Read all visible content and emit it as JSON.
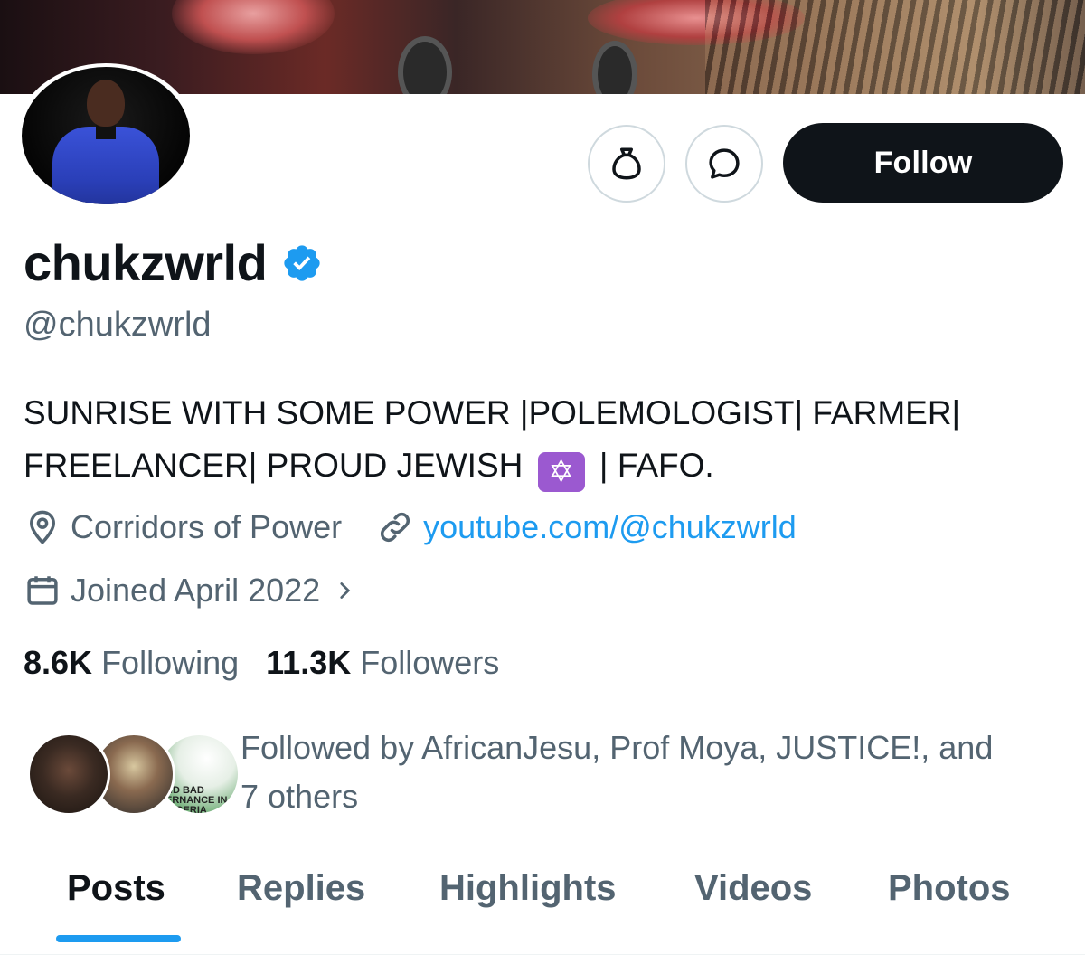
{
  "profile": {
    "display_name": "chukzwrld",
    "handle": "@chukzwrld",
    "verified": true,
    "bio_line1": "SUNRISE WITH SOME POWER |POLEMOLOGIST| FARMER|",
    "bio_line2_a": "FREELANCER| PROUD JEWISH",
    "bio_emoji": "✡️",
    "bio_line2_b": "| FAFO.",
    "location": "Corridors of Power",
    "website": "youtube.com/@chukzwrld",
    "joined": "Joined April 2022"
  },
  "actions": {
    "follow_label": "Follow",
    "bag_icon": "money-bag-icon",
    "message_icon": "message-bubble-icon"
  },
  "stats": {
    "following_count": "8.6K",
    "following_label": "Following",
    "followers_count": "11.3K",
    "followers_label": "Followers"
  },
  "followed_by": {
    "text_line1": "Followed by AfricanJesu, Prof Moya, JUSTICE!, and",
    "text_line2": "7 others",
    "badge_text": "ND BAD ERNANCE IN NIGERIA"
  },
  "tabs": [
    {
      "label": "Posts",
      "active": true
    },
    {
      "label": "Replies",
      "active": false
    },
    {
      "label": "Highlights",
      "active": false
    },
    {
      "label": "Videos",
      "active": false
    },
    {
      "label": "Photos",
      "active": false
    }
  ],
  "colors": {
    "accent": "#1d9bf0",
    "text_primary": "#0f1419",
    "text_secondary": "#536471",
    "follow_button_bg": "#0f1419",
    "emoji_bg": "#9b59d0"
  }
}
